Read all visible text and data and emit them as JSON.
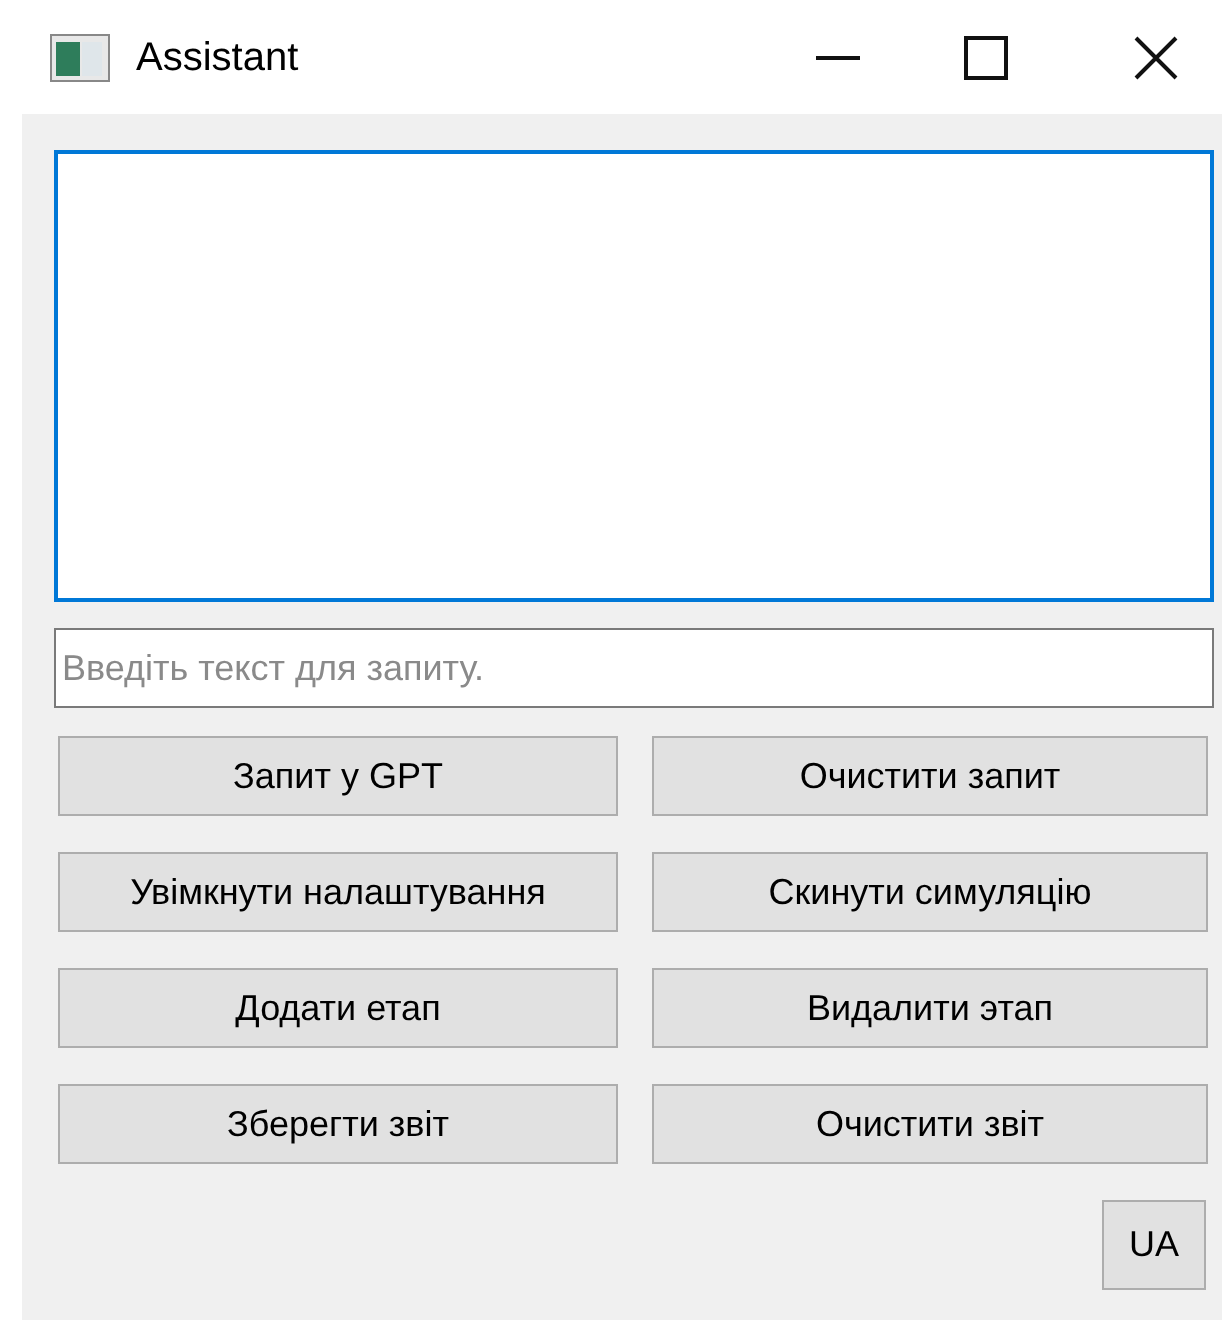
{
  "window": {
    "title": "Assistant"
  },
  "output_box": {
    "focused": true
  },
  "query_field": {
    "placeholder": "Введіть текст для запиту."
  },
  "buttons": [
    "Запит у GPT",
    "Очистити запит",
    "Увімкнути налаштування",
    "Скинути симуляцію",
    "Додати етап",
    "Видалити этап",
    "Зберегти звіт",
    "Очистити звіт"
  ],
  "language_button": "UA"
}
